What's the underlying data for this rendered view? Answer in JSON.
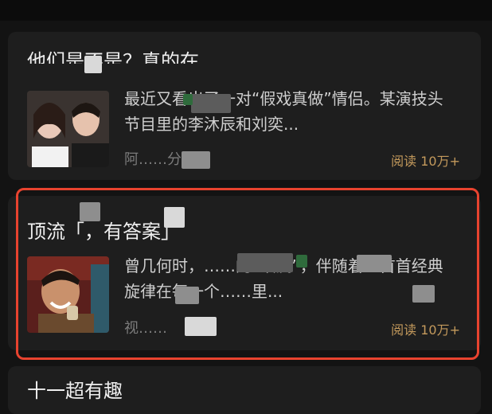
{
  "feed": {
    "articles": [
      {
        "title": "他们是不是？真的在",
        "snippet": "最近又看出了一对“假戏真做”情侣。某演技头节目里的李沐辰和刘奕...",
        "source": "阿……分钟前",
        "reads": "阅读 10万+"
      },
      {
        "title": "顶流「，有答案」",
        "snippet": "曾几何时，……的“顶流”，伴随着一首首经典旋律在每一个……里...",
        "source": "视……",
        "reads": "阅读 10万+"
      },
      {
        "title": "十一超有趣"
      }
    ]
  },
  "colors": {
    "background": "#131313",
    "card": "#1e1e1e",
    "read_count": "#c49a5c",
    "highlight_border": "#e8432f"
  }
}
